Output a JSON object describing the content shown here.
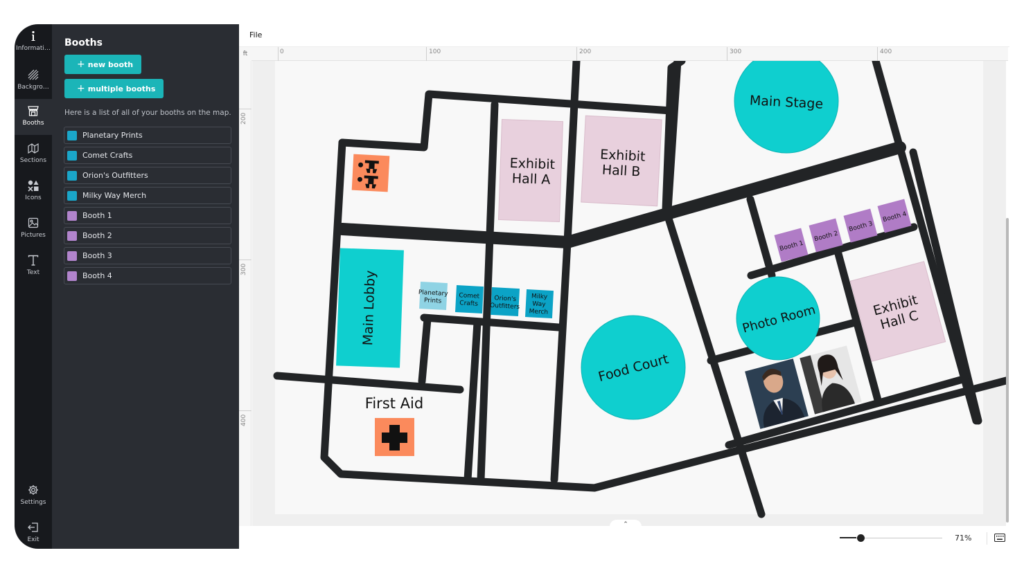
{
  "rail": {
    "items": [
      {
        "label": "Informati…",
        "icon": "info-icon"
      },
      {
        "label": "Backgro…",
        "icon": "background-icon"
      },
      {
        "label": "Booths",
        "icon": "booth-icon",
        "active": true
      },
      {
        "label": "Sections",
        "icon": "sections-icon"
      },
      {
        "label": "Icons",
        "icon": "shapes-icon"
      },
      {
        "label": "Pictures",
        "icon": "picture-icon"
      },
      {
        "label": "Text",
        "icon": "text-icon"
      }
    ],
    "settings_label": "Settings",
    "exit_label": "Exit"
  },
  "panel": {
    "title": "Booths",
    "new_booth_label": "new booth",
    "multiple_booths_label": "multiple booths",
    "description": "Here is a list of all of your booths on the map.",
    "booths": [
      {
        "name": "Planetary Prints",
        "color": "#1aa6c9"
      },
      {
        "name": "Comet Crafts",
        "color": "#1aa6c9"
      },
      {
        "name": "Orion's Outfitters",
        "color": "#1aa6c9"
      },
      {
        "name": "Milky Way Merch",
        "color": "#1aa6c9"
      },
      {
        "name": "Booth 1",
        "color": "#b184cc"
      },
      {
        "name": "Booth 2",
        "color": "#b184cc"
      },
      {
        "name": "Booth 3",
        "color": "#b184cc"
      },
      {
        "name": "Booth 4",
        "color": "#b184cc"
      }
    ]
  },
  "menu": {
    "file": "File"
  },
  "ruler": {
    "unit": "ft",
    "top_ticks": [
      "0",
      "100",
      "200",
      "300",
      "400"
    ],
    "left_ticks": [
      "200",
      "300",
      "400"
    ]
  },
  "map": {
    "labels": {
      "exhibit_hall_a": [
        "Exhibit",
        "Hall A"
      ],
      "exhibit_hall_b": [
        "Exhibit",
        "Hall B"
      ],
      "exhibit_hall_c": [
        "Exhibit",
        "Hall C"
      ],
      "main_stage": "Main Stage",
      "main_lobby": "Main Lobby",
      "food_court": "Food Court",
      "photo_room": "Photo Room",
      "first_aid": "First Aid"
    },
    "small_booths": [
      {
        "lines": [
          "Planetary",
          "Prints"
        ]
      },
      {
        "lines": [
          "Comet",
          "Crafts"
        ]
      },
      {
        "lines": [
          "Orion's",
          "Outfitters"
        ]
      },
      {
        "lines": [
          "Milky",
          "Way",
          "Merch"
        ]
      }
    ],
    "numbered_booths": [
      "Booth 1",
      "Booth 2",
      "Booth 3",
      "Booth 4"
    ],
    "colors": {
      "road": "#222426",
      "teal": "#0fcfcf",
      "hall_pink": "#e8d0dd",
      "booth_blue": "#0ba3c6",
      "booth_light": "#8fd3e4",
      "booth_purple": "#b07cc6",
      "orange": "#fb8a5c",
      "floor": "#f8f8f8"
    }
  },
  "zoom": {
    "value": "71%",
    "level": 0.05
  }
}
